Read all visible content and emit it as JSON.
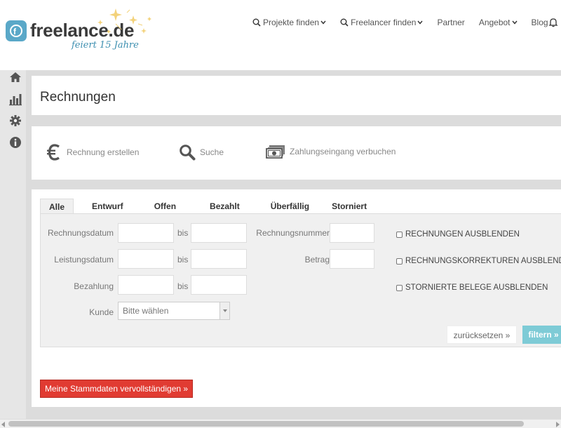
{
  "header": {
    "logo_text": "freelance.de",
    "logo_mark": "f",
    "logo_sub": "feiert 15 Jahre",
    "nav": [
      {
        "label": "Projekte finden",
        "icon": "search-icon",
        "dropdown": true
      },
      {
        "label": "Freelancer finden",
        "icon": "search-icon",
        "dropdown": true
      },
      {
        "label": "Partner"
      },
      {
        "label": "Angebot",
        "dropdown": true
      },
      {
        "label": "Blog"
      }
    ]
  },
  "sidebar": {
    "icons": [
      "home-icon",
      "bar-chart-icon",
      "gear-icon",
      "info-icon"
    ]
  },
  "page": {
    "title": "Rechnungen"
  },
  "actions": [
    {
      "label": "Rechnung erstellen",
      "icon": "euro-icon"
    },
    {
      "label": "Suche",
      "icon": "search-icon"
    },
    {
      "label": "Zahlungseingang verbuchen",
      "icon": "money-icon"
    }
  ],
  "tabs": [
    "Alle",
    "Entwurf",
    "Offen",
    "Bezahlt",
    "Überfällig",
    "Storniert"
  ],
  "active_tab": "Alle",
  "filter": {
    "rechnungsdatum": "Rechnungsdatum",
    "leistungsdatum": "Leistungsdatum",
    "bezahlung": "Bezahlung",
    "kunde": "Kunde",
    "bis": "bis",
    "rechnungsnummer": "Rechnungsnummer",
    "betrag": "Betrag",
    "kunde_select": "Bitte wählen",
    "checks": [
      "RECHNUNGEN AUSBLENDEN",
      "RECHNUNGSKORREKTUREN AUSBLENDEN",
      "STORNIERTE BELEGE AUSBLENDEN"
    ],
    "reset_label": "zurücksetzen »",
    "filter_label": "filtern »"
  },
  "stammdaten_label": "Meine Stammdaten vervollständigen »",
  "colors": {
    "brand": "#5aa8c8",
    "filter_button": "#7ecbd6",
    "cta_red": "#e13b32"
  }
}
